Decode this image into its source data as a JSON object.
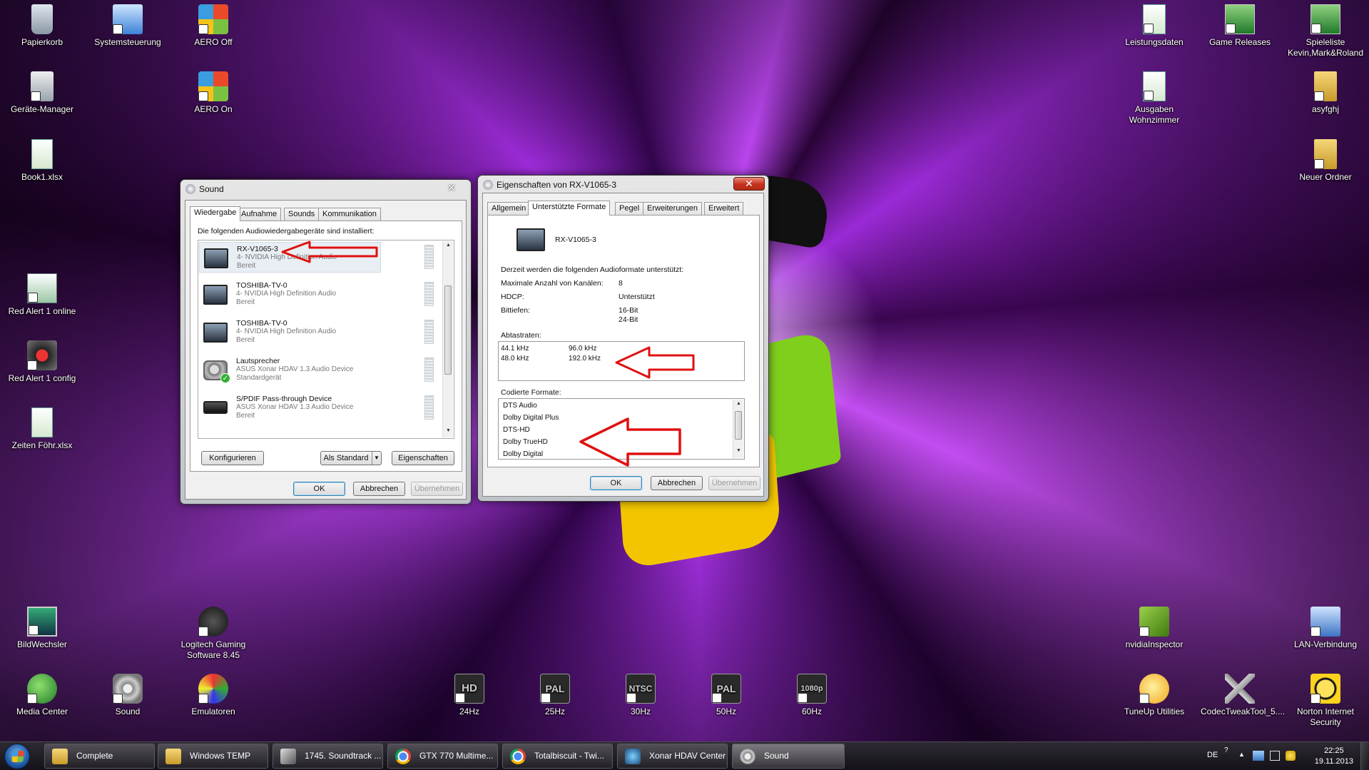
{
  "desktop": {
    "icons": {
      "papierkorb": "Papierkorb",
      "systemsteuerung": "Systemsteuerung",
      "aero_off": "AERO Off",
      "geraete_manager": "Geräte-Manager",
      "aero_on": "AERO On",
      "book1": "Book1.xlsx",
      "red_alert_online": "Red Alert 1 online",
      "red_alert_config": "Red Alert 1 config",
      "zeiten": "Zeiten Föhr.xlsx",
      "bildwechsler": "BildWechsler",
      "logitech": "Logitech Gaming Software 8.45",
      "media_center": "Media Center",
      "sound": "Sound",
      "emulatoren": "Emulatoren",
      "hz24": "24Hz",
      "hz25": "25Hz",
      "hz30": "30Hz",
      "hz50": "50Hz",
      "hz60": "60Hz",
      "leistungsdaten": "Leistungsdaten",
      "game_releases": "Game Releases",
      "spieleliste": "Spieleliste Kevin,Mark&Roland",
      "ausgaben": "Ausgaben Wohnzimmer",
      "asyfghj": "asyfghj",
      "neuer_ordner": "Neuer Ordner",
      "nvidia_inspector": "nvidiaInspector",
      "lan": "LAN-Verbindung",
      "tuneup": "TuneUp Utilities",
      "codectweak": "CodecTweakTool_5....",
      "norton": "Norton Internet Security"
    },
    "hz_badges": {
      "hd": "HD",
      "pal1": "PAL",
      "ntsc": "NTSC",
      "pal2": "PAL",
      "p1080": "1080p"
    }
  },
  "sound_dialog": {
    "title": "Sound",
    "close": "✕",
    "tabs": [
      "Wiedergabe",
      "Aufnahme",
      "Sounds",
      "Kommunikation"
    ],
    "intro": "Die folgenden Audiowiedergabegeräte sind installiert:",
    "devices": [
      {
        "name": "RX-V1065-3",
        "driver": "4- NVIDIA High Definition Audio",
        "status": "Bereit"
      },
      {
        "name": "TOSHIBA-TV-0",
        "driver": "4- NVIDIA High Definition Audio",
        "status": "Bereit"
      },
      {
        "name": "TOSHIBA-TV-0",
        "driver": "4- NVIDIA High Definition Audio",
        "status": "Bereit"
      },
      {
        "name": "Lautsprecher",
        "driver": "ASUS Xonar HDAV 1.3 Audio Device",
        "status": "Standardgerät"
      },
      {
        "name": "S/PDIF Pass-through Device",
        "driver": "ASUS Xonar HDAV 1.3 Audio Device",
        "status": "Bereit"
      }
    ],
    "buttons": {
      "konfigurieren": "Konfigurieren",
      "als_standard": "Als Standard",
      "eigenschaften": "Eigenschaften",
      "ok": "OK",
      "abbrechen": "Abbrechen",
      "uebernehmen": "Übernehmen"
    }
  },
  "props_dialog": {
    "title": "Eigenschaften von RX-V1065-3",
    "close": "✕",
    "tabs": [
      "Allgemein",
      "Unterstützte Formate",
      "Pegel",
      "Erweiterungen",
      "Erweitert"
    ],
    "device_name": "RX-V1065-3",
    "intro": "Derzeit werden die folgenden Audioformate unterstützt:",
    "rows": [
      {
        "label": "Maximale Anzahl von Kanälen:",
        "value": "8"
      },
      {
        "label": "HDCP:",
        "value": "Unterstützt"
      },
      {
        "label": "Bittiefen:",
        "value": "16-Bit",
        "value2": "24-Bit"
      }
    ],
    "abtastraten_label": "Abtastraten:",
    "abtastraten": [
      [
        "44.1 kHz",
        "96.0 kHz"
      ],
      [
        "48.0 kHz",
        "192.0 kHz"
      ]
    ],
    "codierte_label": "Codierte Formate:",
    "codierte": [
      "DTS Audio",
      "Dolby Digital Plus",
      "DTS-HD",
      "Dolby TrueHD",
      "Dolby Digital"
    ],
    "buttons": {
      "ok": "OK",
      "abbrechen": "Abbrechen",
      "uebernehmen": "Übernehmen"
    }
  },
  "taskbar": {
    "items": [
      "Complete",
      "Windows TEMP",
      "1745. Soundtrack ...",
      "GTX 770 Multime...",
      "Totalbiscuit - Twi...",
      "Xonar HDAV Center",
      "Sound"
    ],
    "lang": "DE",
    "time": "22:25",
    "date": "19.11.2013"
  }
}
